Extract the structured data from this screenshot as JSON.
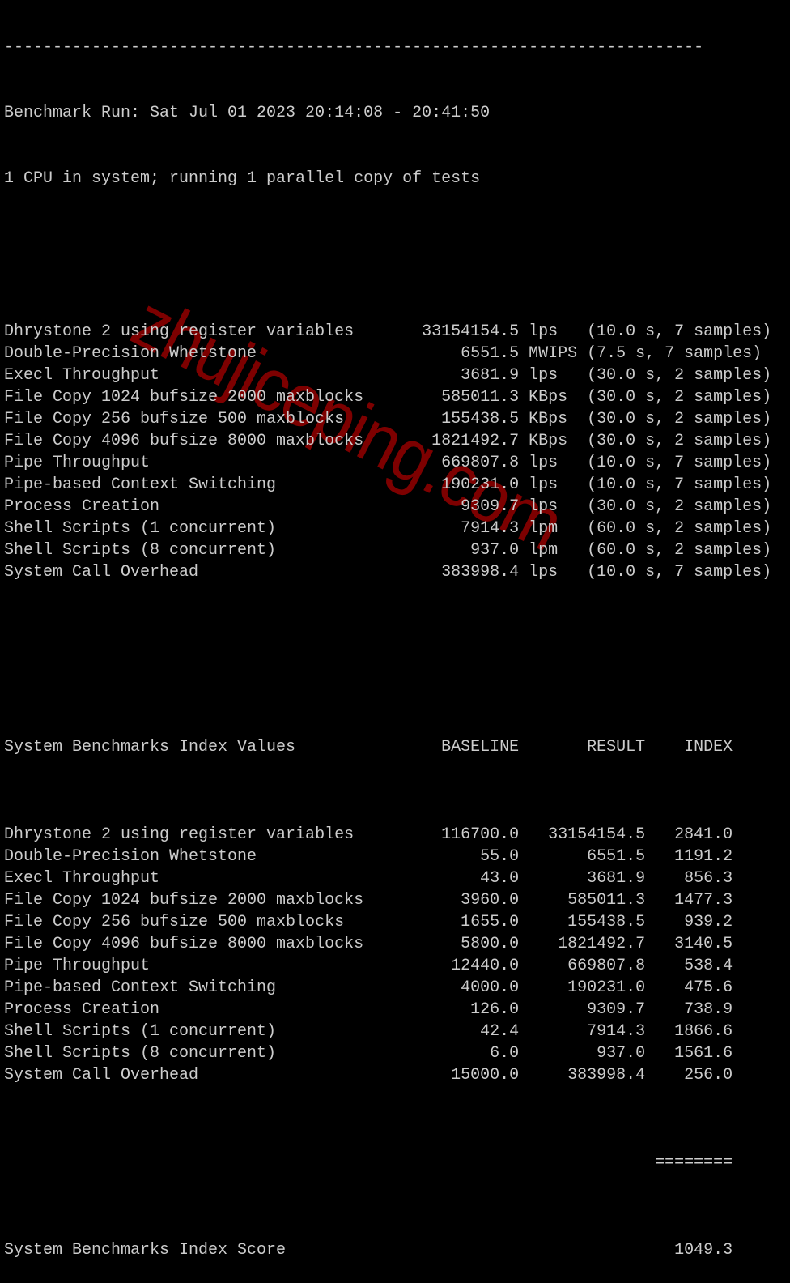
{
  "terminal": {
    "separator": "------------------------------------------------------------------------",
    "run_line": "Benchmark Run: Sat Jul 01 2023 20:14:08 - 20:41:50",
    "cpu_line": "1 CPU in system; running 1 parallel copy of tests",
    "results": [
      {
        "name": "Dhrystone 2 using register variables",
        "value": "33154154.5",
        "unit": "lps",
        "detail": "(10.0 s, 7 samples)"
      },
      {
        "name": "Double-Precision Whetstone",
        "value": "6551.5",
        "unit": "MWIPS",
        "detail": "(7.5 s, 7 samples)"
      },
      {
        "name": "Execl Throughput",
        "value": "3681.9",
        "unit": "lps",
        "detail": "(30.0 s, 2 samples)"
      },
      {
        "name": "File Copy 1024 bufsize 2000 maxblocks",
        "value": "585011.3",
        "unit": "KBps",
        "detail": "(30.0 s, 2 samples)"
      },
      {
        "name": "File Copy 256 bufsize 500 maxblocks",
        "value": "155438.5",
        "unit": "KBps",
        "detail": "(30.0 s, 2 samples)"
      },
      {
        "name": "File Copy 4096 bufsize 8000 maxblocks",
        "value": "1821492.7",
        "unit": "KBps",
        "detail": "(30.0 s, 2 samples)"
      },
      {
        "name": "Pipe Throughput",
        "value": "669807.8",
        "unit": "lps",
        "detail": "(10.0 s, 7 samples)"
      },
      {
        "name": "Pipe-based Context Switching",
        "value": "190231.0",
        "unit": "lps",
        "detail": "(10.0 s, 7 samples)"
      },
      {
        "name": "Process Creation",
        "value": "9309.7",
        "unit": "lps",
        "detail": "(30.0 s, 2 samples)"
      },
      {
        "name": "Shell Scripts (1 concurrent)",
        "value": "7914.3",
        "unit": "lpm",
        "detail": "(60.0 s, 2 samples)"
      },
      {
        "name": "Shell Scripts (8 concurrent)",
        "value": "937.0",
        "unit": "lpm",
        "detail": "(60.0 s, 2 samples)"
      },
      {
        "name": "System Call Overhead",
        "value": "383998.4",
        "unit": "lps",
        "detail": "(10.0 s, 7 samples)"
      }
    ],
    "index_header": {
      "title": "System Benchmarks Index Values",
      "baseline": "BASELINE",
      "result": "RESULT",
      "index": "INDEX"
    },
    "index_rows": [
      {
        "name": "Dhrystone 2 using register variables",
        "baseline": "116700.0",
        "result": "33154154.5",
        "index": "2841.0"
      },
      {
        "name": "Double-Precision Whetstone",
        "baseline": "55.0",
        "result": "6551.5",
        "index": "1191.2"
      },
      {
        "name": "Execl Throughput",
        "baseline": "43.0",
        "result": "3681.9",
        "index": "856.3"
      },
      {
        "name": "File Copy 1024 bufsize 2000 maxblocks",
        "baseline": "3960.0",
        "result": "585011.3",
        "index": "1477.3"
      },
      {
        "name": "File Copy 256 bufsize 500 maxblocks",
        "baseline": "1655.0",
        "result": "155438.5",
        "index": "939.2"
      },
      {
        "name": "File Copy 4096 bufsize 8000 maxblocks",
        "baseline": "5800.0",
        "result": "1821492.7",
        "index": "3140.5"
      },
      {
        "name": "Pipe Throughput",
        "baseline": "12440.0",
        "result": "669807.8",
        "index": "538.4"
      },
      {
        "name": "Pipe-based Context Switching",
        "baseline": "4000.0",
        "result": "190231.0",
        "index": "475.6"
      },
      {
        "name": "Process Creation",
        "baseline": "126.0",
        "result": "9309.7",
        "index": "738.9"
      },
      {
        "name": "Shell Scripts (1 concurrent)",
        "baseline": "42.4",
        "result": "7914.3",
        "index": "1866.6"
      },
      {
        "name": "Shell Scripts (8 concurrent)",
        "baseline": "6.0",
        "result": "937.0",
        "index": "1561.6"
      },
      {
        "name": "System Call Overhead",
        "baseline": "15000.0",
        "result": "383998.4",
        "index": "256.0"
      }
    ],
    "score_rule": "========",
    "score_label": "System Benchmarks Index Score",
    "score_value": "1049.3"
  },
  "watermark": {
    "text": "zhujiceping.com",
    "color": "#7d0000"
  },
  "colors": {
    "background": "#000000",
    "text": "#cccccc"
  }
}
